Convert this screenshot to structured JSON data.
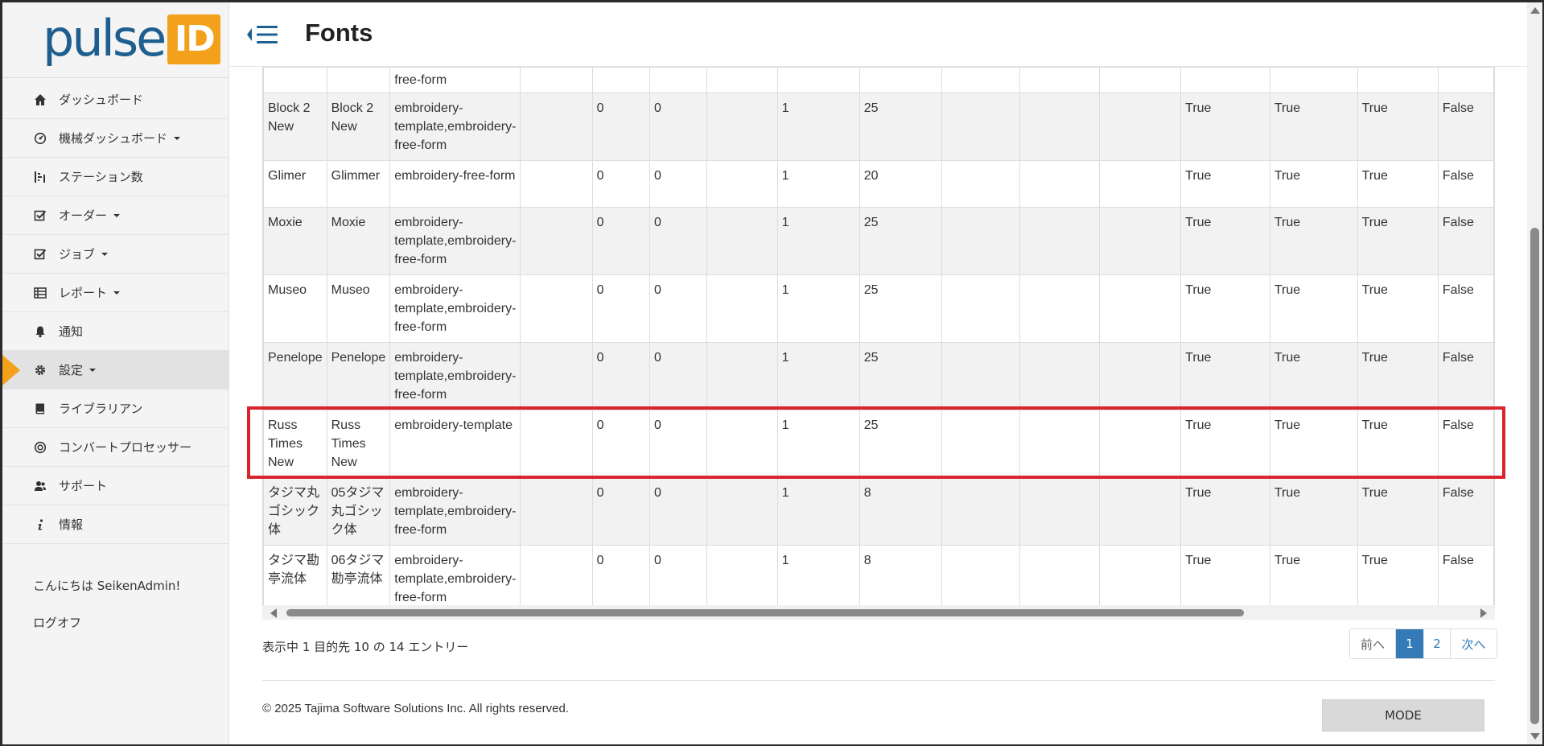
{
  "app": {
    "logo_word": "pulse",
    "logo_badge": "ID",
    "page_title": "Fonts",
    "colors": {
      "brand_blue": "#1f5f8f",
      "brand_orange": "#f3a11b",
      "highlight_red": "#d9232d",
      "active_page": "#337ab7"
    }
  },
  "sidebar": {
    "items": [
      {
        "label": "ダッシュボード",
        "icon": "home-icon",
        "dropdown": false,
        "active": false
      },
      {
        "label": "機械ダッシュボード",
        "icon": "gauge-icon",
        "dropdown": true,
        "active": false
      },
      {
        "label": "ステーション数",
        "icon": "stations-icon",
        "dropdown": false,
        "active": false
      },
      {
        "label": "オーダー",
        "icon": "check-square-icon",
        "dropdown": true,
        "active": false
      },
      {
        "label": "ジョブ",
        "icon": "check-square-icon",
        "dropdown": true,
        "active": false
      },
      {
        "label": "レポート",
        "icon": "table-icon",
        "dropdown": true,
        "active": false
      },
      {
        "label": "通知",
        "icon": "bell-icon",
        "dropdown": false,
        "active": false
      },
      {
        "label": "設定",
        "icon": "gear-icon",
        "dropdown": true,
        "active": true
      },
      {
        "label": "ライブラリアン",
        "icon": "book-icon",
        "dropdown": false,
        "active": false
      },
      {
        "label": "コンバートプロセッサー",
        "icon": "target-icon",
        "dropdown": false,
        "active": false
      },
      {
        "label": "サポート",
        "icon": "users-icon",
        "dropdown": false,
        "active": false
      },
      {
        "label": "情報",
        "icon": "info-icon",
        "dropdown": false,
        "active": false
      }
    ],
    "greeting": "こんにちは SeikenAdmin!",
    "logoff": "ログオフ"
  },
  "table": {
    "rows": [
      [
        "",
        "",
        "free-form",
        "",
        "",
        "",
        "",
        "",
        "",
        "",
        "",
        "",
        "",
        "",
        ""
      ],
      [
        "Block 2 New",
        "Block 2 New",
        "embroidery-template,embroidery-free-form",
        "",
        "0",
        "0",
        "",
        "1",
        "25",
        "",
        "",
        "",
        "True",
        "True",
        "True",
        "False"
      ],
      [
        "Glimer",
        "Glimmer",
        "embroidery-free-form",
        "",
        "0",
        "0",
        "",
        "1",
        "20",
        "",
        "",
        "",
        "True",
        "True",
        "True",
        "False"
      ],
      [
        "Moxie",
        "Moxie",
        "embroidery-template,embroidery-free-form",
        "",
        "0",
        "0",
        "",
        "1",
        "25",
        "",
        "",
        "",
        "True",
        "True",
        "True",
        "False"
      ],
      [
        "Museo",
        "Museo",
        "embroidery-template,embroidery-free-form",
        "",
        "0",
        "0",
        "",
        "1",
        "25",
        "",
        "",
        "",
        "True",
        "True",
        "True",
        "False"
      ],
      [
        "Penelope",
        "Penelope",
        "embroidery-template,embroidery-free-form",
        "",
        "0",
        "0",
        "",
        "1",
        "25",
        "",
        "",
        "",
        "True",
        "True",
        "True",
        "False"
      ],
      [
        "Russ Times New",
        "Russ Times New",
        "embroidery-template",
        "",
        "0",
        "0",
        "",
        "1",
        "25",
        "",
        "",
        "",
        "True",
        "True",
        "True",
        "False"
      ],
      [
        "タジマ丸ゴシック体",
        "05タジマ丸ゴシック体",
        "embroidery-template,embroidery-free-form",
        "",
        "0",
        "0",
        "",
        "1",
        "8",
        "",
        "",
        "",
        "True",
        "True",
        "True",
        "False"
      ],
      [
        "タジマ勘亭流体",
        "06タジマ勘亭流体",
        "embroidery-template,embroidery-free-form",
        "",
        "0",
        "0",
        "",
        "1",
        "8",
        "",
        "",
        "",
        "True",
        "True",
        "True",
        "False"
      ]
    ]
  },
  "pagination": {
    "info": "表示中 1 目的先 10 の 14 エントリー",
    "prev": "前へ",
    "pages": [
      "1",
      "2"
    ],
    "current": "1",
    "next": "次へ"
  },
  "footer": {
    "copyright": "© 2025 Tajima Software Solutions Inc. All rights reserved.",
    "mode_button": "MODE"
  }
}
